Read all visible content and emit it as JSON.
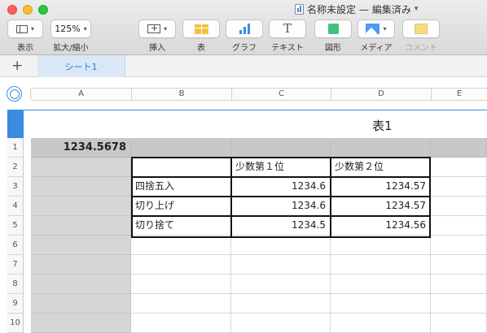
{
  "window": {
    "title": "名称未設定",
    "status": "— 編集済み"
  },
  "toolbar": {
    "view_label": "表示",
    "zoom_value": "125%",
    "zoom_label": "拡大/縮小",
    "insert_label": "挿入",
    "table_label": "表",
    "chart_label": "グラフ",
    "text_label": "テキスト",
    "shape_label": "図形",
    "media_label": "メディア",
    "comment_label": "コメント"
  },
  "sheets": {
    "add_label": "+",
    "active_tab": "シート1"
  },
  "columns": [
    "A",
    "B",
    "C",
    "D",
    "E"
  ],
  "table": {
    "name": "表1",
    "rows": [
      {
        "num": "1",
        "cells": [
          "1234.5678",
          "",
          "",
          "",
          ""
        ]
      },
      {
        "num": "2",
        "cells": [
          "",
          "",
          "少数第１位",
          "少数第２位",
          ""
        ]
      },
      {
        "num": "3",
        "cells": [
          "",
          "四捨五入",
          "1234.6",
          "1234.57",
          ""
        ]
      },
      {
        "num": "4",
        "cells": [
          "",
          "切り上げ",
          "1234.6",
          "1234.57",
          ""
        ]
      },
      {
        "num": "5",
        "cells": [
          "",
          "切り捨て",
          "1234.5",
          "1234.56",
          ""
        ]
      },
      {
        "num": "6",
        "cells": [
          "",
          "",
          "",
          "",
          ""
        ]
      },
      {
        "num": "7",
        "cells": [
          "",
          "",
          "",
          "",
          ""
        ]
      },
      {
        "num": "8",
        "cells": [
          "",
          "",
          "",
          "",
          ""
        ]
      },
      {
        "num": "9",
        "cells": [
          "",
          "",
          "",
          "",
          ""
        ]
      },
      {
        "num": "10",
        "cells": [
          "",
          "",
          "",
          "",
          ""
        ]
      }
    ]
  },
  "colors": {
    "accent": "#3b8be0",
    "header_row_fill": "#c8c8c8",
    "header_column_fill": "#d6d6d6"
  }
}
